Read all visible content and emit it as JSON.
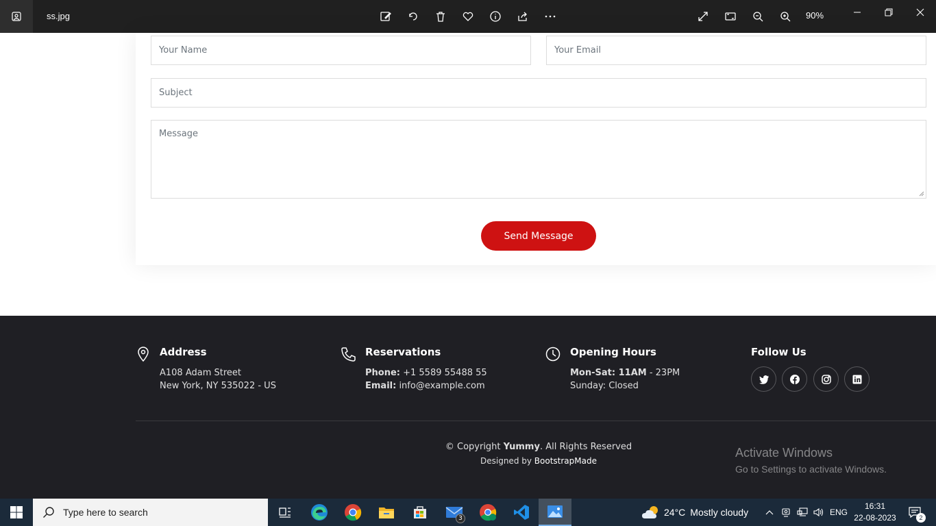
{
  "titlebar": {
    "filename": "ss.jpg",
    "zoom": "90%",
    "icons": [
      "photos-app-icon",
      "edit-image-icon",
      "rotate-icon",
      "delete-icon",
      "favorite-icon",
      "info-icon",
      "share-icon",
      "more-icon",
      "fullscreen-icon",
      "fit-window-icon",
      "zoom-out-icon",
      "zoom-in-icon",
      "minimize-icon",
      "restore-icon",
      "close-icon"
    ]
  },
  "form": {
    "name_placeholder": "Your Name",
    "email_placeholder": "Your Email",
    "subject_placeholder": "Subject",
    "message_placeholder": "Message",
    "send_label": "Send Message",
    "accent_color": "#ce1212"
  },
  "footer": {
    "address": {
      "title": "Address",
      "line1": "A108 Adam Street",
      "line2": "New York, NY 535022 - US",
      "icon": "map-pin-icon"
    },
    "reservations": {
      "title": "Reservations",
      "phone_label": "Phone:",
      "phone": " +1 5589 55488 55",
      "email_label": "Email:",
      "email": " info@example.com",
      "icon": "phone-icon"
    },
    "hours": {
      "title": "Opening Hours",
      "days_label": "Mon-Sat:",
      "open": " 11AM",
      "close": " - 23PM",
      "sunday": "Sunday: Closed",
      "icon": "clock-icon"
    },
    "follow": {
      "title": "Follow Us",
      "networks": [
        "twitter",
        "facebook",
        "instagram",
        "linkedin"
      ]
    },
    "copyright_prefix": "© Copyright ",
    "brand": "Yummy",
    "copyright_suffix": ". All Rights Reserved",
    "designed_by": "Designed by ",
    "designer": "BootstrapMade",
    "background": "#1f1f24"
  },
  "watermark": {
    "title": "Activate Windows",
    "subtitle": "Go to Settings to activate Windows."
  },
  "taskbar": {
    "search_placeholder": "Type here to search",
    "apps": [
      "task-view",
      "edge",
      "chrome",
      "file-explorer",
      "microsoft-store",
      "mail",
      "chrome-profile",
      "vscode",
      "photos"
    ],
    "mail_badge": "3",
    "weather_temp": "24°C",
    "weather_desc": "Mostly cloudy",
    "language": "ENG",
    "time": "16:31",
    "date": "22-08-2023",
    "notifications": "2"
  }
}
